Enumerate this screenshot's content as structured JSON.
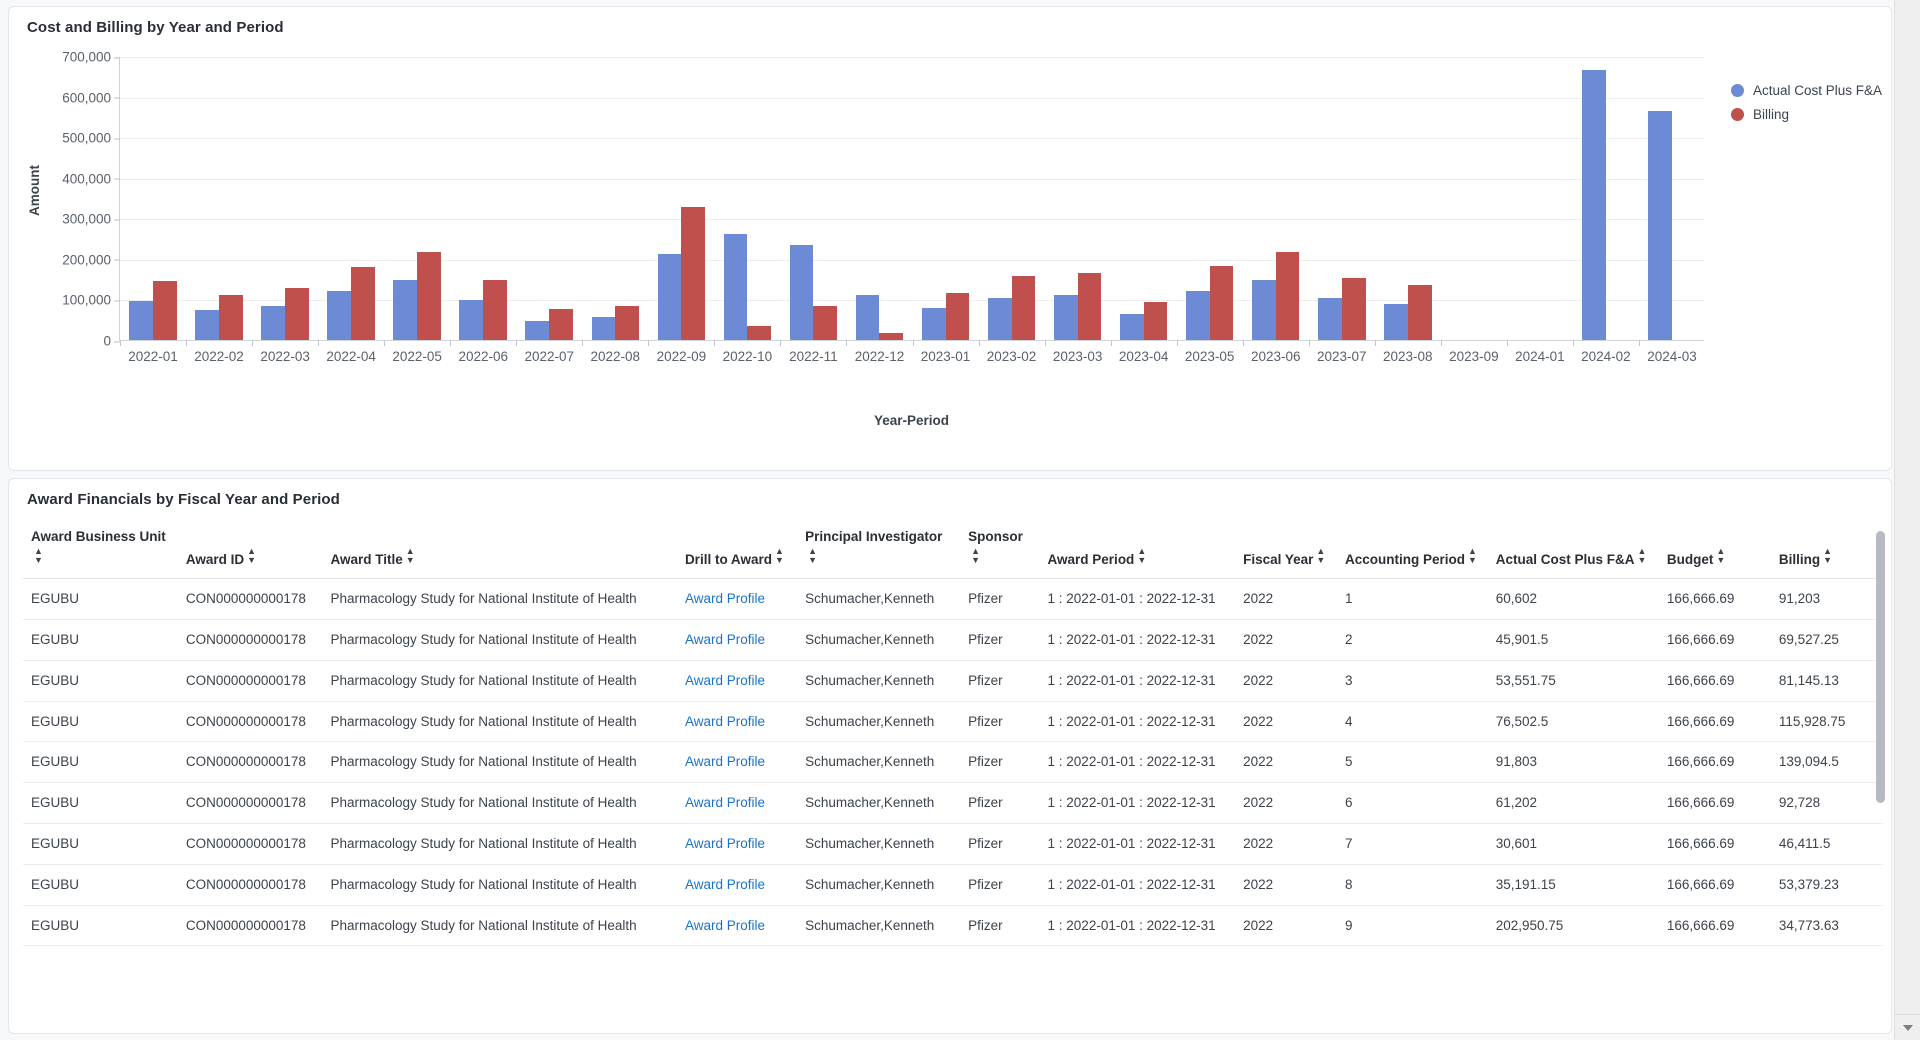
{
  "chart_card": {
    "title": "Cost and Billing by Year and Period"
  },
  "chart_data": {
    "type": "bar",
    "title": "Cost and Billing by Year and Period",
    "xlabel": "Year-Period",
    "ylabel": "Amount",
    "ylim": [
      0,
      700000
    ],
    "yticks": [
      "0",
      "100,000",
      "200,000",
      "300,000",
      "400,000",
      "500,000",
      "600,000",
      "700,000"
    ],
    "grid": true,
    "legend_position": "right",
    "colors": {
      "actual_cost_plus_fa": "#6d8ad4",
      "billing": "#c0504d"
    },
    "categories": [
      "2022-01",
      "2022-02",
      "2022-03",
      "2022-04",
      "2022-05",
      "2022-06",
      "2022-07",
      "2022-08",
      "2022-09",
      "2022-10",
      "2022-11",
      "2022-12",
      "2023-01",
      "2023-02",
      "2023-03",
      "2023-04",
      "2023-05",
      "2023-06",
      "2023-07",
      "2023-08",
      "2023-09",
      "2024-01",
      "2024-02",
      "2024-03"
    ],
    "series": [
      {
        "name": "Actual Cost Plus F&A",
        "color": "#6d8ad4",
        "values": [
          97000,
          73000,
          85000,
          121000,
          147000,
          98000,
          48000,
          56000,
          213000,
          262000,
          234000,
          111000,
          78000,
          104000,
          110000,
          63000,
          120000,
          147000,
          103000,
          89000,
          0,
          0,
          666000,
          565000
        ]
      },
      {
        "name": "Billing",
        "color": "#c0504d",
        "values": [
          145000,
          110000,
          128000,
          181000,
          217000,
          148000,
          76000,
          84000,
          328000,
          35000,
          85000,
          17000,
          117000,
          158000,
          165000,
          93000,
          183000,
          218000,
          154000,
          135000,
          0,
          0,
          0,
          0
        ]
      }
    ]
  },
  "legend": [
    {
      "label": "Actual Cost Plus F&A",
      "color": "#6d8ad4"
    },
    {
      "label": "Billing",
      "color": "#c0504d"
    }
  ],
  "table_card": {
    "title": "Award Financials by Fiscal Year and Period",
    "columns": [
      "Award Business Unit",
      "Award ID",
      "Award Title",
      "Drill to Award",
      "Principal Investigator",
      "Sponsor",
      "Award Period",
      "Fiscal Year",
      "Accounting Period",
      "Actual Cost Plus F&A",
      "Budget",
      "Billing"
    ],
    "rows": [
      {
        "business_unit": "EGUBU",
        "award_id": "CON000000000178",
        "award_title": "Pharmacology Study for National Institute of Health",
        "drill": "Award Profile",
        "pi": "Schumacher,Kenneth",
        "sponsor": "Pfizer",
        "award_period": "1 : 2022-01-01 : 2022-12-31",
        "fiscal_year": "2022",
        "accounting_period": "1",
        "actual_cost_plus_fa": "60,602",
        "budget": "166,666.69",
        "billing": "91,203"
      },
      {
        "business_unit": "EGUBU",
        "award_id": "CON000000000178",
        "award_title": "Pharmacology Study for National Institute of Health",
        "drill": "Award Profile",
        "pi": "Schumacher,Kenneth",
        "sponsor": "Pfizer",
        "award_period": "1 : 2022-01-01 : 2022-12-31",
        "fiscal_year": "2022",
        "accounting_period": "2",
        "actual_cost_plus_fa": "45,901.5",
        "budget": "166,666.69",
        "billing": "69,527.25"
      },
      {
        "business_unit": "EGUBU",
        "award_id": "CON000000000178",
        "award_title": "Pharmacology Study for National Institute of Health",
        "drill": "Award Profile",
        "pi": "Schumacher,Kenneth",
        "sponsor": "Pfizer",
        "award_period": "1 : 2022-01-01 : 2022-12-31",
        "fiscal_year": "2022",
        "accounting_period": "3",
        "actual_cost_plus_fa": "53,551.75",
        "budget": "166,666.69",
        "billing": "81,145.13"
      },
      {
        "business_unit": "EGUBU",
        "award_id": "CON000000000178",
        "award_title": "Pharmacology Study for National Institute of Health",
        "drill": "Award Profile",
        "pi": "Schumacher,Kenneth",
        "sponsor": "Pfizer",
        "award_period": "1 : 2022-01-01 : 2022-12-31",
        "fiscal_year": "2022",
        "accounting_period": "4",
        "actual_cost_plus_fa": "76,502.5",
        "budget": "166,666.69",
        "billing": "115,928.75"
      },
      {
        "business_unit": "EGUBU",
        "award_id": "CON000000000178",
        "award_title": "Pharmacology Study for National Institute of Health",
        "drill": "Award Profile",
        "pi": "Schumacher,Kenneth",
        "sponsor": "Pfizer",
        "award_period": "1 : 2022-01-01 : 2022-12-31",
        "fiscal_year": "2022",
        "accounting_period": "5",
        "actual_cost_plus_fa": "91,803",
        "budget": "166,666.69",
        "billing": "139,094.5"
      },
      {
        "business_unit": "EGUBU",
        "award_id": "CON000000000178",
        "award_title": "Pharmacology Study for National Institute of Health",
        "drill": "Award Profile",
        "pi": "Schumacher,Kenneth",
        "sponsor": "Pfizer",
        "award_period": "1 : 2022-01-01 : 2022-12-31",
        "fiscal_year": "2022",
        "accounting_period": "6",
        "actual_cost_plus_fa": "61,202",
        "budget": "166,666.69",
        "billing": "92,728"
      },
      {
        "business_unit": "EGUBU",
        "award_id": "CON000000000178",
        "award_title": "Pharmacology Study for National Institute of Health",
        "drill": "Award Profile",
        "pi": "Schumacher,Kenneth",
        "sponsor": "Pfizer",
        "award_period": "1 : 2022-01-01 : 2022-12-31",
        "fiscal_year": "2022",
        "accounting_period": "7",
        "actual_cost_plus_fa": "30,601",
        "budget": "166,666.69",
        "billing": "46,411.5"
      },
      {
        "business_unit": "EGUBU",
        "award_id": "CON000000000178",
        "award_title": "Pharmacology Study for National Institute of Health",
        "drill": "Award Profile",
        "pi": "Schumacher,Kenneth",
        "sponsor": "Pfizer",
        "award_period": "1 : 2022-01-01 : 2022-12-31",
        "fiscal_year": "2022",
        "accounting_period": "8",
        "actual_cost_plus_fa": "35,191.15",
        "budget": "166,666.69",
        "billing": "53,379.23"
      },
      {
        "business_unit": "EGUBU",
        "award_id": "CON000000000178",
        "award_title": "Pharmacology Study for National Institute of Health",
        "drill": "Award Profile",
        "pi": "Schumacher,Kenneth",
        "sponsor": "Pfizer",
        "award_period": "1 : 2022-01-01 : 2022-12-31",
        "fiscal_year": "2022",
        "accounting_period": "9",
        "actual_cost_plus_fa": "202,950.75",
        "budget": "166,666.69",
        "billing": "34,773.63"
      }
    ]
  }
}
